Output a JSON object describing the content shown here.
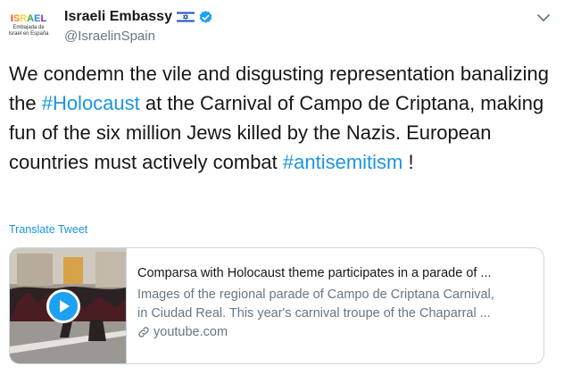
{
  "author": {
    "avatar_logo": "ISRAEL",
    "avatar_logo_letters": [
      "I",
      "S",
      "R",
      "A",
      "E",
      "L"
    ],
    "avatar_logo_colors": [
      "#e53935",
      "#fb8c00",
      "#fdd835",
      "#43a047",
      "#1e88e5",
      "#8e24aa"
    ],
    "avatar_subtitle": "Embajada de Israel en España",
    "display_name": "Israeli Embassy",
    "handle": "@IsraelinSpain",
    "flag_icon": "israel-flag-icon",
    "verified_icon": "verified-badge-icon",
    "verified_color": "#1da1f2"
  },
  "tweet": {
    "text_1": "We condemn the vile and disgusting representation banalizing the ",
    "hashtag_1": "#Holocaust",
    "text_2": " at the Carnival of Campo de Criptana, making fun of the six million Jews killed by the Nazis. European countries must actively combat ",
    "hashtag_2": "#antisemitism",
    "text_3": " !",
    "hashtag_color": "#1b95e0"
  },
  "translate_label": "Translate Tweet",
  "card": {
    "title": "Comparsa with Holocaust theme participates in a parade of ...",
    "desc_line_1": "Images of the regional parade of Campo de Criptana Carnival,",
    "desc_line_2": "in Ciudad Real. This year's carnival troupe of the Chaparral ...",
    "domain": "youtube.com",
    "play_icon": "play-icon",
    "link_icon": "link-icon"
  }
}
